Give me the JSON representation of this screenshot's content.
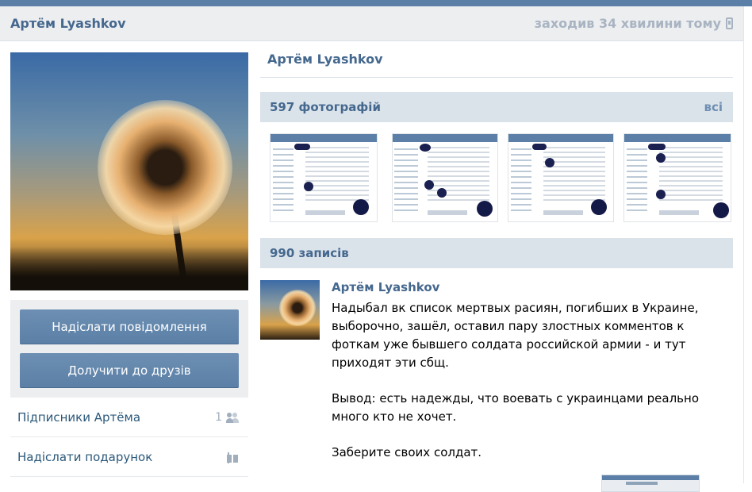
{
  "header": {
    "name": "Артём Lyashkov",
    "status": "заходив 34 хвилини тому"
  },
  "sidebar": {
    "buttons": {
      "send_message": "Надіслати повідомлення",
      "add_friend": "Долучити до друзів"
    },
    "menu": [
      {
        "label": "Підписники Артёма",
        "count": "1",
        "icon": "users-icon"
      },
      {
        "label": "Надіслати подарунок",
        "icon": "gift-icon"
      }
    ]
  },
  "profile": {
    "name": "Артём Lyashkov"
  },
  "photos": {
    "title": "597 фотографій",
    "all_link": "всі"
  },
  "records": {
    "title": "990 записів"
  },
  "post": {
    "author": "Артём Lyashkov",
    "paragraphs": [
      "Надыбал вк список мертвых расиян, погибших в Украине, выборочно, зашёл, оставил пару злостных комментов к фоткам уже бывшего солдата российской армии - и тут приходят эти сбщ.",
      "Вывод: есть надежды, что воевать с украинцами реально много кто не хочет.",
      "Заберите своих солдат."
    ]
  },
  "colors": {
    "brand": "#5b7fa6",
    "link": "#45688e",
    "section_bg": "#dae2ea",
    "panel_bg": "#edeef0"
  }
}
